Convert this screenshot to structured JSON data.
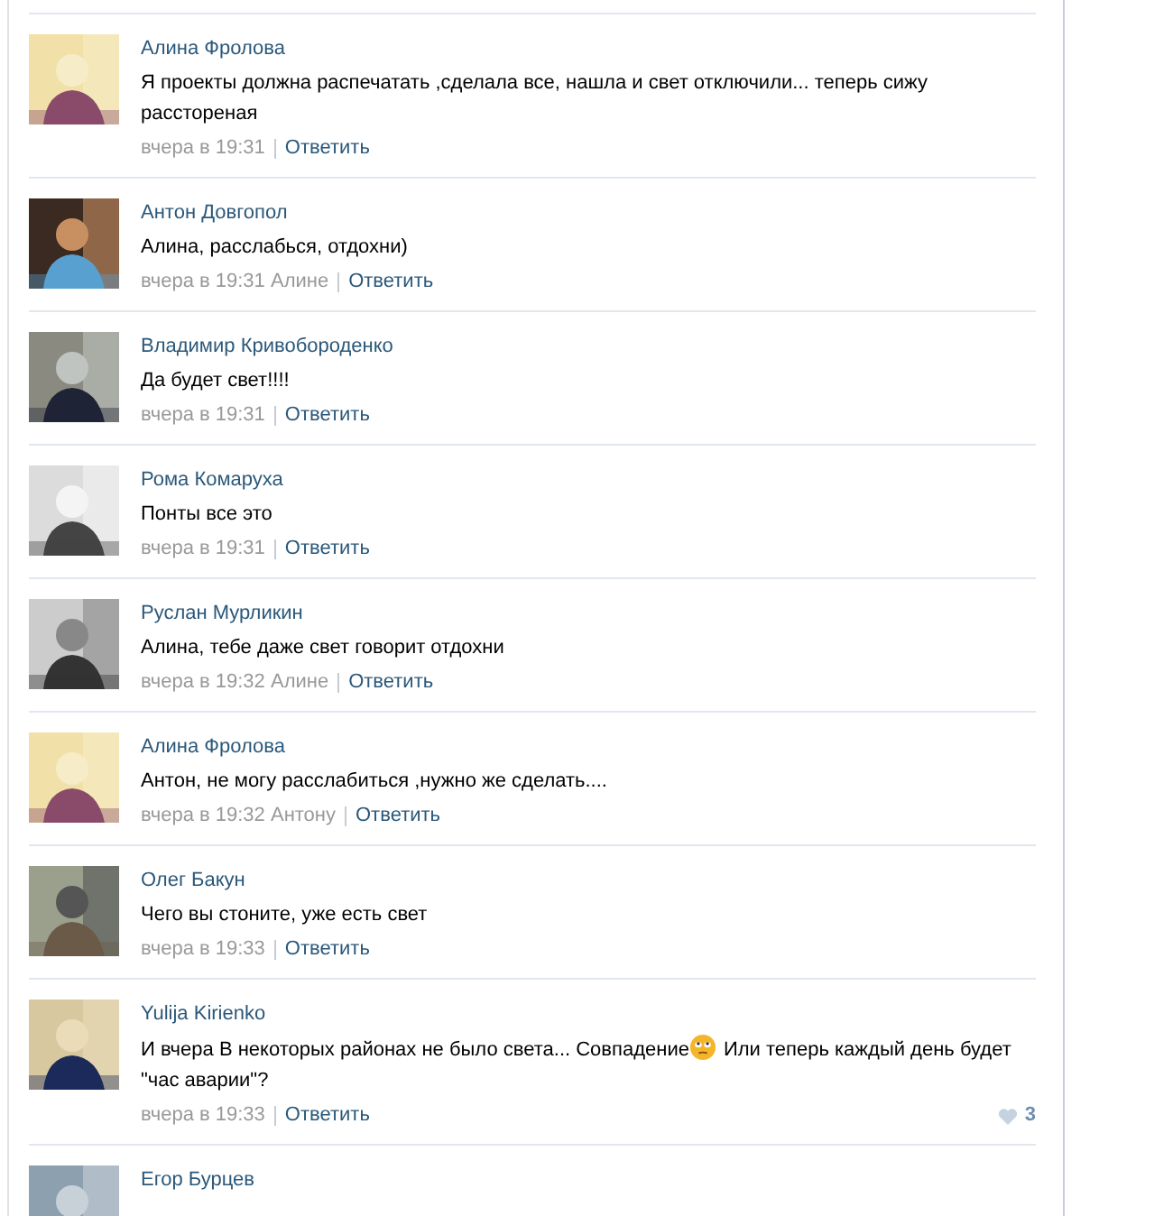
{
  "comments": [
    {
      "author": "Алина Фролова",
      "text": [
        {
          "kind": "text",
          "value": "Я проекты должна распечатать ,сделала все, нашла и свет отключили... теперь сижу расстореная"
        }
      ],
      "date": "вчера в 19:31",
      "reply_action": "Ответить"
    },
    {
      "author": "Антон Довгопол",
      "text": [
        {
          "kind": "text",
          "value": "Алина, расслабься, отдохни)"
        }
      ],
      "date": "вчера в 19:31",
      "reply_to": "Алине",
      "reply_action": "Ответить"
    },
    {
      "author": "Владимир Кривобороденко",
      "text": [
        {
          "kind": "text",
          "value": "Да будет свет!!!!"
        }
      ],
      "date": "вчера в 19:31",
      "reply_action": "Ответить"
    },
    {
      "author": "Рома Комаруха",
      "text": [
        {
          "kind": "text",
          "value": "Понты все это"
        }
      ],
      "date": "вчера в 19:31",
      "reply_action": "Ответить"
    },
    {
      "author": "Руслан Мурликин",
      "text": [
        {
          "kind": "text",
          "value": "Алина, тебе даже свет говорит отдохни"
        }
      ],
      "date": "вчера в 19:32",
      "reply_to": "Алине",
      "reply_action": "Ответить"
    },
    {
      "author": "Алина Фролова",
      "text": [
        {
          "kind": "text",
          "value": "Антон, не могу расслабиться ,нужно же сделать...."
        }
      ],
      "date": "вчера в 19:32",
      "reply_to": "Антону",
      "reply_action": "Ответить"
    },
    {
      "author": "Олег Бакун",
      "text": [
        {
          "kind": "text",
          "value": "Чего вы стоните, уже есть свет"
        }
      ],
      "date": "вчера в 19:33",
      "reply_action": "Ответить"
    },
    {
      "author": "Yulija Kirienko",
      "text": [
        {
          "kind": "text",
          "value": "И вчера В некоторых районах не было света... Совпадение"
        },
        {
          "kind": "emoji"
        },
        {
          "kind": "text",
          "value": "Или теперь каждый день будет"
        },
        {
          "kind": "text",
          "value": "\"час аварии\"?"
        }
      ],
      "date": "вчера в 19:33",
      "reply_action": "Ответить",
      "likes": "3"
    },
    {
      "author": "Егор Бурцев"
    }
  ]
}
